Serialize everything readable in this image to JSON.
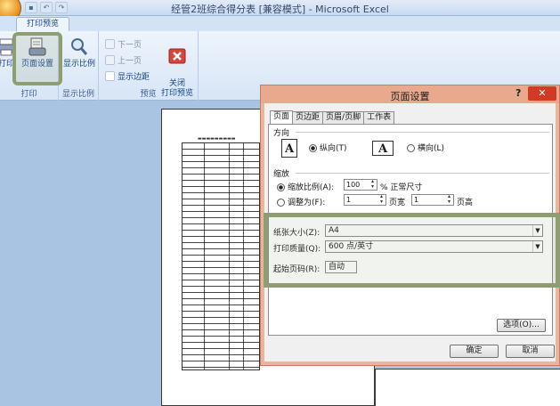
{
  "window": {
    "title": "经管2班综合得分表 [兼容模式] - Microsoft Excel",
    "qat_icons": [
      "save-icon",
      "undo-icon",
      "redo-icon"
    ]
  },
  "ribbon": {
    "tab": "打印预览",
    "groups": {
      "print": {
        "label": "打印",
        "print_btn": "打印",
        "page_setup_btn": "页面设置"
      },
      "zoom": {
        "label": "显示比例",
        "zoom_btn": "显示比例"
      },
      "preview": {
        "label": "预览",
        "next_page": "下一页",
        "prev_page": "上一页",
        "show_margins": "显示边距",
        "close_preview": "关闭\n打印预览"
      }
    }
  },
  "dialog": {
    "title": "页面设置",
    "help": "?",
    "close": "✕",
    "tabs": [
      "页面",
      "页边距",
      "页眉/页脚",
      "工作表"
    ],
    "orientation": {
      "label": "方向",
      "portrait": "纵向(T)",
      "landscape": "横向(L)",
      "selected": "portrait"
    },
    "scaling": {
      "label": "缩放",
      "adjust_to": "缩放比例(A):",
      "adjust_value": "100",
      "adjust_unit": "% 正常尺寸",
      "fit_to": "调整为(F):",
      "pages_wide": "1",
      "wide_label": "页宽",
      "pages_tall": "1",
      "tall_label": "页高"
    },
    "paper_size": {
      "label": "纸张大小(Z):",
      "value": "A4"
    },
    "print_quality": {
      "label": "打印质量(Q):",
      "value": "600 点/英寸"
    },
    "first_page": {
      "label": "起始页码(R):",
      "value": "自动"
    },
    "options_btn": "选项(O)...",
    "ok_btn": "确定",
    "cancel_btn": "取消"
  }
}
